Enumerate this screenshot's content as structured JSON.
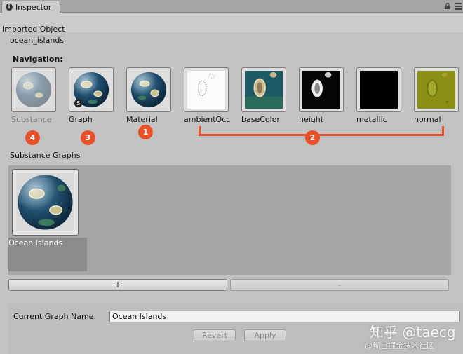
{
  "tab": {
    "label": "Inspector"
  },
  "header": {
    "imported_object": "Imported Object",
    "object_name": "ocean_islands"
  },
  "navigation": {
    "label": "Navigation:",
    "items": [
      {
        "label": "Substance",
        "badge": "4"
      },
      {
        "label": "Graph",
        "badge": "3"
      },
      {
        "label": "Material",
        "badge": "1"
      },
      {
        "label": "ambientOcc"
      },
      {
        "label": "baseColor"
      },
      {
        "label": "height"
      },
      {
        "label": "metallic"
      },
      {
        "label": "normal"
      }
    ],
    "texture_badge": "2"
  },
  "substance_graphs": {
    "label": "Substance Graphs",
    "items": [
      {
        "name": "Ocean Islands"
      }
    ],
    "add_label": "+",
    "remove_label": "-"
  },
  "current_graph": {
    "label": "Current Graph Name:",
    "value": "Ocean Islands",
    "revert_label": "Revert",
    "apply_label": "Apply"
  },
  "watermark": {
    "line1": "知乎 @taecg",
    "line2": "@稀土掘金技术社区"
  },
  "colors": {
    "accent": "#e8502a",
    "background": "#c2c2c2",
    "panel": "#a5a5a5"
  }
}
